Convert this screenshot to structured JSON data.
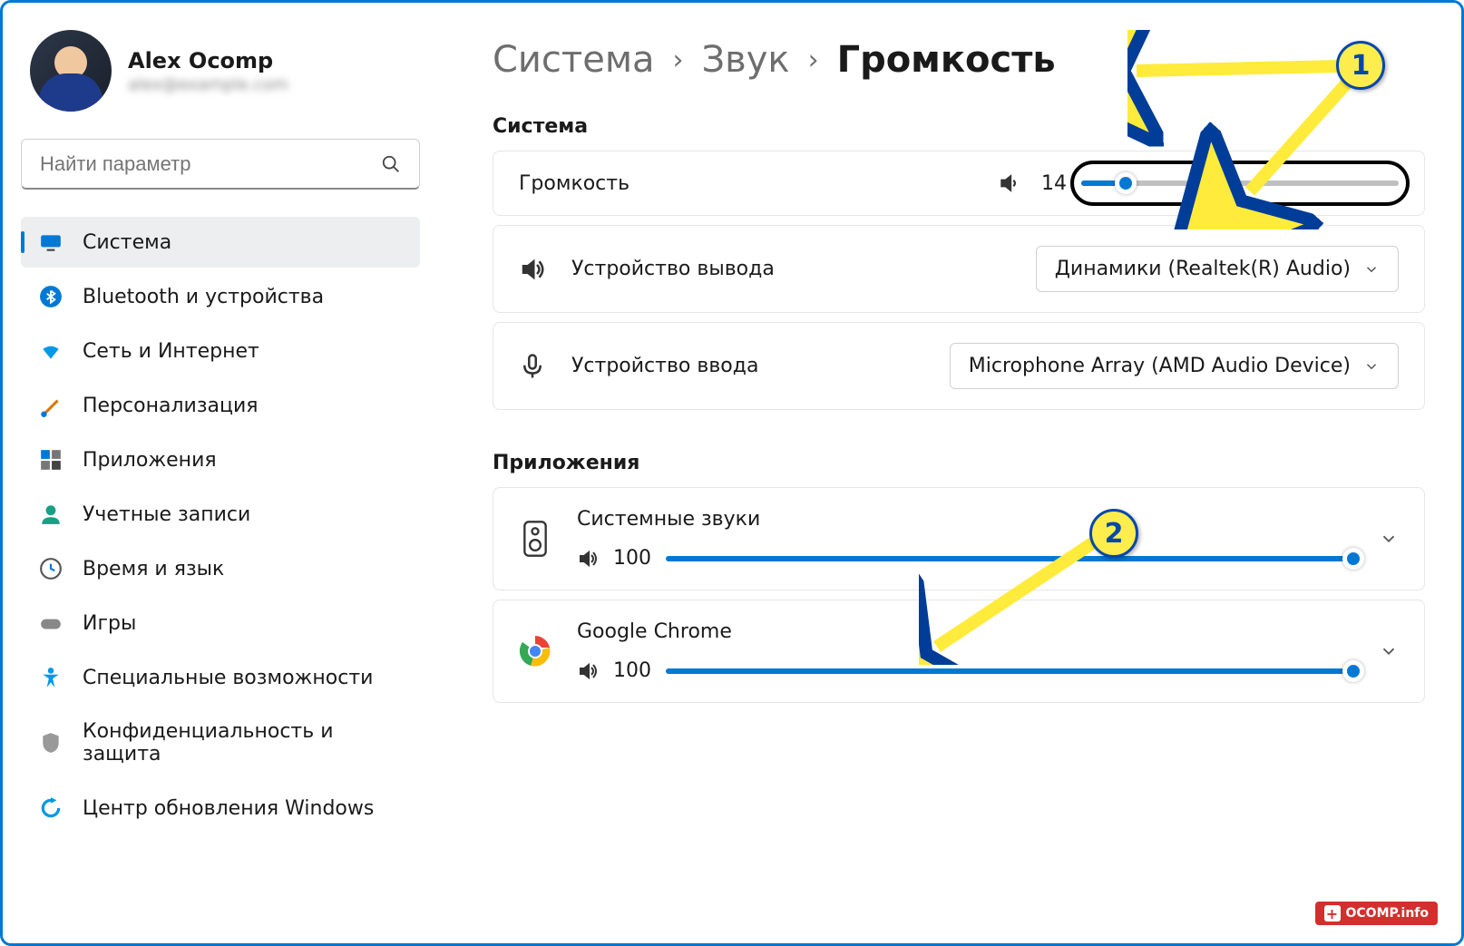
{
  "profile": {
    "name": "Alex Ocomp",
    "email_masked": "alex@example.com"
  },
  "search": {
    "placeholder": "Найти параметр"
  },
  "sidebar": {
    "items": [
      {
        "label": "Система",
        "icon": "system"
      },
      {
        "label": "Bluetooth и устройства",
        "icon": "bluetooth"
      },
      {
        "label": "Сеть и Интернет",
        "icon": "wifi"
      },
      {
        "label": "Персонализация",
        "icon": "brush"
      },
      {
        "label": "Приложения",
        "icon": "apps"
      },
      {
        "label": "Учетные записи",
        "icon": "account"
      },
      {
        "label": "Время и язык",
        "icon": "clock"
      },
      {
        "label": "Игры",
        "icon": "games"
      },
      {
        "label": "Специальные возможности",
        "icon": "accessibility"
      },
      {
        "label": "Конфиденциальность и защита",
        "icon": "shield"
      },
      {
        "label": "Центр обновления Windows",
        "icon": "update"
      }
    ]
  },
  "breadcrumb": {
    "l1": "Система",
    "l2": "Звук",
    "current": "Громкость"
  },
  "sections": {
    "system": "Система",
    "apps": "Приложения"
  },
  "system_rows": {
    "volume": {
      "label": "Громкость",
      "value": 14,
      "tooltip": 14
    },
    "output": {
      "label": "Устройство вывода",
      "device": "Динамики (Realtek(R) Audio)"
    },
    "input": {
      "label": "Устройство ввода",
      "device": "Microphone Array (AMD Audio Device)"
    }
  },
  "apps": [
    {
      "name": "Системные звуки",
      "volume": 100,
      "icon": "speaker-device"
    },
    {
      "name": "Google Chrome",
      "volume": 100,
      "icon": "chrome"
    }
  ],
  "annotations": {
    "n1": "1",
    "n2": "2"
  },
  "watermark": "OCOMP.info"
}
